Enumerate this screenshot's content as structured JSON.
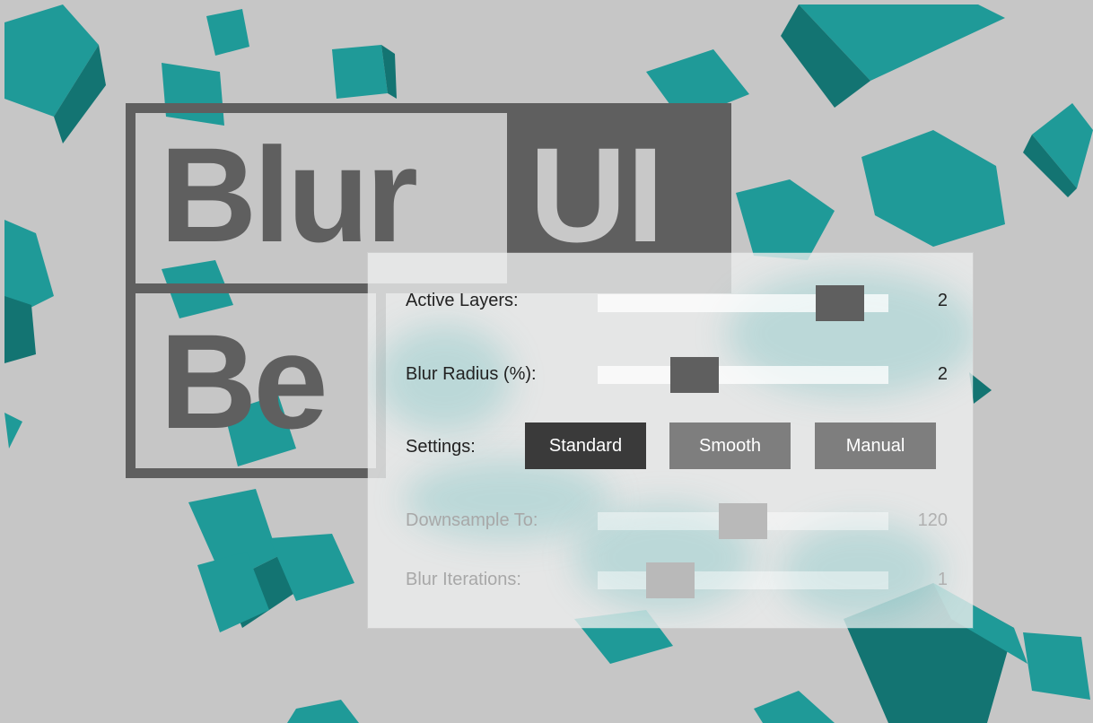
{
  "logo": {
    "word1": "Blur",
    "word2": "UI",
    "word3": "Be"
  },
  "panel": {
    "active_layers": {
      "label": "Active Layers:",
      "value": "2",
      "level": 0.9
    },
    "blur_radius": {
      "label": "Blur Radius (%):",
      "value": "2",
      "level": 0.3
    },
    "settings": {
      "label": "Settings:",
      "options": [
        "Standard",
        "Smooth",
        "Manual"
      ],
      "selected": "Standard"
    },
    "downsample": {
      "label": "Downsample To:",
      "value": "120",
      "level": 0.5,
      "enabled": false
    },
    "blur_iterations": {
      "label": "Blur Iterations:",
      "value": "1",
      "level": 0.2,
      "enabled": false
    }
  },
  "colors": {
    "background": "#c8c8c8",
    "cube_teal": "#1f9a98",
    "logo_gray": "#5f5f5f",
    "button_active": "#3a3a3a",
    "button_normal": "#7e7e7e"
  }
}
